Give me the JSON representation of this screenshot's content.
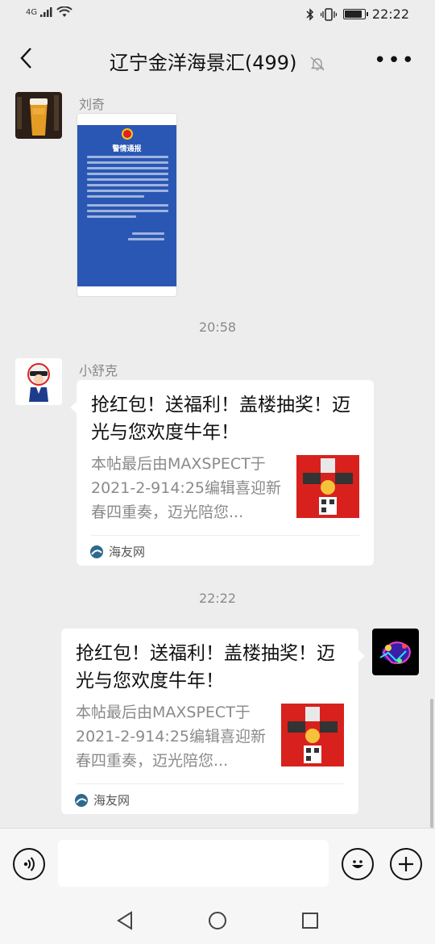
{
  "status_bar": {
    "network": "4G",
    "time": "22:22",
    "battery_level": 0.8
  },
  "header": {
    "title": "辽宁金洋海景汇(499)"
  },
  "messages": {
    "m1": {
      "sender": "刘奇",
      "image_heading": "警情通报"
    },
    "time1": "20:58",
    "m2": {
      "sender": "小舒克",
      "title": "抢红包！送福利！盖楼抽奖！迈光与您欢度牛年！",
      "desc": "本帖最后由MAXSPECT于2021-2-914:25编辑喜迎新春四重奏，迈光陪您...",
      "source": "海友网"
    },
    "time2": "22:22",
    "m3": {
      "title": "抢红包！送福利！盖楼抽奖！迈光与您欢度牛年！",
      "desc": "本帖最后由MAXSPECT于2021-2-914:25编辑喜迎新春四重奏，迈光陪您...",
      "source": "海友网"
    }
  },
  "colors": {
    "background": "#ededed",
    "bubble": "#ffffff",
    "secondary_text": "#8a8a8a",
    "thumb_red": "#d8211d"
  }
}
